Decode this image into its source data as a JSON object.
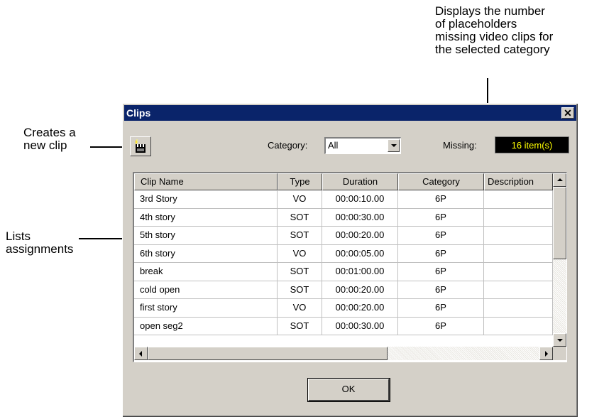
{
  "callouts": {
    "missing": [
      "Displays the number",
      "of placeholders",
      "missing video clips for",
      "the selected category"
    ],
    "new_clip": [
      "Creates a",
      "new clip"
    ],
    "lists": [
      "Lists",
      "assignments"
    ]
  },
  "dialog": {
    "title": "Clips",
    "close_glyph": "✕",
    "category_label": "Category:",
    "category_value": "All",
    "missing_label": "Missing:",
    "missing_value": "16 item(s)",
    "ok_label": "OK",
    "icons": {
      "new_clip": "clapperboard-icon",
      "close": "close-icon"
    },
    "colors": {
      "titlebar": "#0a246a",
      "missing_bg": "#000000",
      "missing_text": "#ffff00"
    }
  },
  "table": {
    "columns": [
      "Clip Name",
      "Type",
      "Duration",
      "Category",
      "Description"
    ],
    "rows": [
      [
        "3rd Story",
        "VO",
        "00:00:10.00",
        "6P",
        ""
      ],
      [
        "4th story",
        "SOT",
        "00:00:30.00",
        "6P",
        ""
      ],
      [
        "5th story",
        "SOT",
        "00:00:20.00",
        "6P",
        ""
      ],
      [
        "6th story",
        "VO",
        "00:00:05.00",
        "6P",
        ""
      ],
      [
        "break",
        "SOT",
        "00:01:00.00",
        "6P",
        ""
      ],
      [
        "cold open",
        "SOT",
        "00:00:20.00",
        "6P",
        ""
      ],
      [
        "first story",
        "VO",
        "00:00:20.00",
        "6P",
        ""
      ],
      [
        "open seg2",
        "SOT",
        "00:00:30.00",
        "6P",
        ""
      ]
    ]
  }
}
